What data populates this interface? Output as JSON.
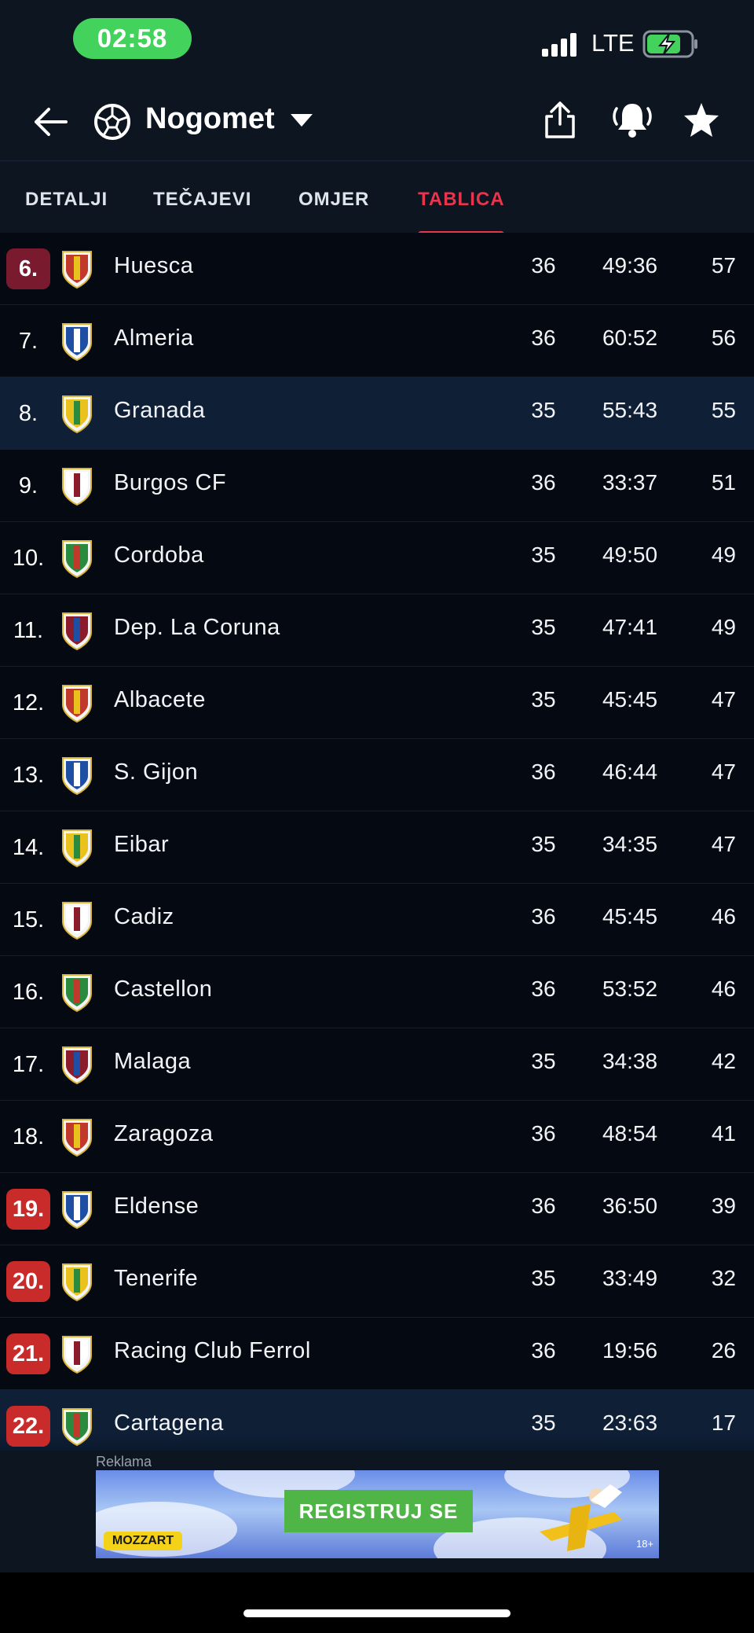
{
  "status_bar": {
    "time": "02:58",
    "network": "LTE"
  },
  "header": {
    "title": "Nogomet"
  },
  "tabs": [
    {
      "label": "DETALJI",
      "active": false
    },
    {
      "label": "TEČAJEVI",
      "active": false
    },
    {
      "label": "OMJER",
      "active": false
    },
    {
      "label": "TABLICA",
      "active": true
    }
  ],
  "standings": [
    {
      "rank": "6.",
      "team": "Huesca",
      "played": "36",
      "score": "49:36",
      "points": "57",
      "badge": "maroon",
      "highlight": false
    },
    {
      "rank": "7.",
      "team": "Almeria",
      "played": "36",
      "score": "60:52",
      "points": "56",
      "badge": "",
      "highlight": false
    },
    {
      "rank": "8.",
      "team": "Granada",
      "played": "35",
      "score": "55:43",
      "points": "55",
      "badge": "",
      "highlight": true
    },
    {
      "rank": "9.",
      "team": "Burgos CF",
      "played": "36",
      "score": "33:37",
      "points": "51",
      "badge": "",
      "highlight": false
    },
    {
      "rank": "10.",
      "team": "Cordoba",
      "played": "35",
      "score": "49:50",
      "points": "49",
      "badge": "",
      "highlight": false
    },
    {
      "rank": "11.",
      "team": "Dep. La Coruna",
      "played": "35",
      "score": "47:41",
      "points": "49",
      "badge": "",
      "highlight": false
    },
    {
      "rank": "12.",
      "team": "Albacete",
      "played": "35",
      "score": "45:45",
      "points": "47",
      "badge": "",
      "highlight": false
    },
    {
      "rank": "13.",
      "team": "S. Gijon",
      "played": "36",
      "score": "46:44",
      "points": "47",
      "badge": "",
      "highlight": false
    },
    {
      "rank": "14.",
      "team": "Eibar",
      "played": "35",
      "score": "34:35",
      "points": "47",
      "badge": "",
      "highlight": false
    },
    {
      "rank": "15.",
      "team": "Cadiz",
      "played": "36",
      "score": "45:45",
      "points": "46",
      "badge": "",
      "highlight": false
    },
    {
      "rank": "16.",
      "team": "Castellon",
      "played": "36",
      "score": "53:52",
      "points": "46",
      "badge": "",
      "highlight": false
    },
    {
      "rank": "17.",
      "team": "Malaga",
      "played": "35",
      "score": "34:38",
      "points": "42",
      "badge": "",
      "highlight": false
    },
    {
      "rank": "18.",
      "team": "Zaragoza",
      "played": "36",
      "score": "48:54",
      "points": "41",
      "badge": "",
      "highlight": false
    },
    {
      "rank": "19.",
      "team": "Eldense",
      "played": "36",
      "score": "36:50",
      "points": "39",
      "badge": "red",
      "highlight": false
    },
    {
      "rank": "20.",
      "team": "Tenerife",
      "played": "35",
      "score": "33:49",
      "points": "32",
      "badge": "red",
      "highlight": false
    },
    {
      "rank": "21.",
      "team": "Racing Club Ferrol",
      "played": "36",
      "score": "19:56",
      "points": "26",
      "badge": "red",
      "highlight": false
    },
    {
      "rank": "22.",
      "team": "Cartagena",
      "played": "35",
      "score": "23:63",
      "points": "17",
      "badge": "red",
      "highlight": true
    }
  ],
  "ad": {
    "label": "Reklama",
    "cta": "REGISTRUJ SE",
    "brand": "MOZZART",
    "age": "18+"
  },
  "colors": {
    "accent": "#e8354d",
    "badge_maroon": "#7a1a2e",
    "badge_red": "#c92a2a",
    "highlight_row": "#0f1f36",
    "time_pill": "#43d35c"
  }
}
